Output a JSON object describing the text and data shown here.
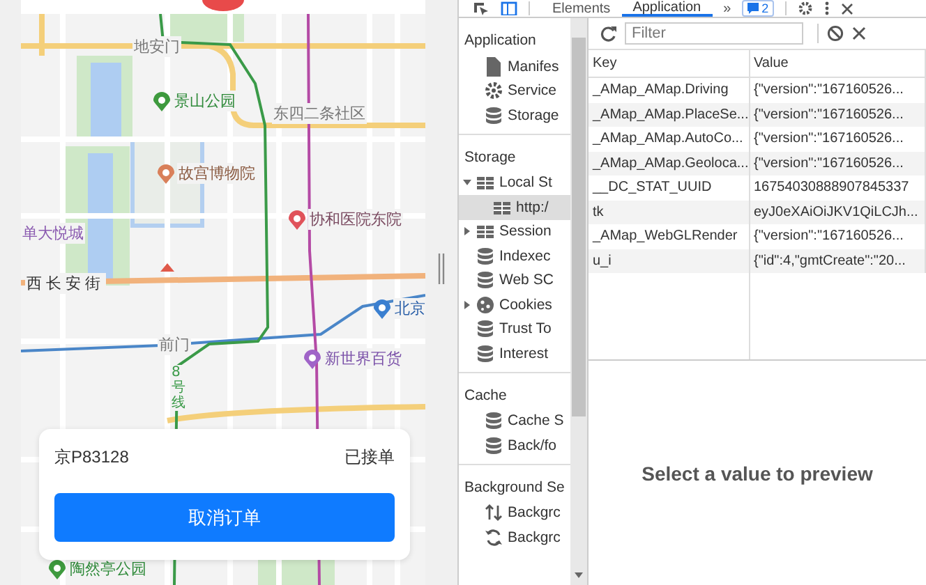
{
  "map": {
    "labels": [
      {
        "text": "地安门",
        "kind": "area"
      },
      {
        "text": "景山公园",
        "kind": "park"
      },
      {
        "text": "东四二条社区",
        "kind": "area"
      },
      {
        "text": "故宫博物院",
        "kind": "museum"
      },
      {
        "text": "协和医院东院",
        "kind": "hospital"
      },
      {
        "text": "单大悦城",
        "kind": "mall"
      },
      {
        "text": "西长安街",
        "kind": "road"
      },
      {
        "text": "北京",
        "kind": "station"
      },
      {
        "text": "前门",
        "kind": "area"
      },
      {
        "text": "新世界百货",
        "kind": "shop"
      },
      {
        "text": "8号线",
        "kind": "metro"
      },
      {
        "text": "陶然亭公园",
        "kind": "park"
      }
    ]
  },
  "order_card": {
    "plate": "京P83128",
    "status": "已接单",
    "cancel_button": "取消订单"
  },
  "devtools": {
    "tabs": [
      {
        "label": "Elements",
        "selected": false
      },
      {
        "label": "Application",
        "selected": true
      }
    ],
    "more_tabs": "»",
    "issues_badge": "2",
    "filter": {
      "placeholder": "Filter"
    },
    "sidebar": [
      {
        "title": "Application",
        "items": [
          {
            "label": "Manifes",
            "kind": "file",
            "selected": false
          },
          {
            "label": "Service",
            "kind": "gear",
            "selected": false
          },
          {
            "label": "Storage",
            "kind": "database",
            "selected": false
          }
        ]
      },
      {
        "title": "Storage",
        "items": [
          {
            "label": "Local St",
            "kind": "table",
            "selected": false,
            "expanded": true,
            "children": [
              {
                "label": "http:/",
                "kind": "table",
                "selected": true
              }
            ]
          },
          {
            "label": "Session",
            "kind": "table",
            "selected": false,
            "expanded": false
          },
          {
            "label": "Indexec",
            "kind": "database",
            "selected": false
          },
          {
            "label": "Web SC",
            "kind": "database",
            "selected": false
          },
          {
            "label": "Cookies",
            "kind": "cookie",
            "selected": false,
            "expanded": false
          },
          {
            "label": "Trust To",
            "kind": "database",
            "selected": false
          },
          {
            "label": "Interest",
            "kind": "database",
            "selected": false
          }
        ]
      },
      {
        "title": "Cache",
        "items": [
          {
            "label": "Cache S",
            "kind": "database",
            "selected": false
          },
          {
            "label": "Back/fo",
            "kind": "database",
            "selected": false
          }
        ]
      },
      {
        "title": "Background Se",
        "items": [
          {
            "label": "Backgrc",
            "kind": "fetch",
            "selected": false
          },
          {
            "label": "Backgrc",
            "kind": "sync",
            "selected": false
          }
        ]
      }
    ],
    "table": {
      "columns": [
        "Key",
        "Value"
      ],
      "rows": [
        [
          "_AMap_AMap.Driving",
          "{\"version\":\"167160526..."
        ],
        [
          "_AMap_AMap.PlaceSe...",
          "{\"version\":\"167160526..."
        ],
        [
          "_AMap_AMap.AutoCo...",
          "{\"version\":\"167160526..."
        ],
        [
          "_AMap_AMap.Geoloca...",
          "{\"version\":\"167160526..."
        ],
        [
          "__DC_STAT_UUID",
          "16754030888907845337"
        ],
        [
          "tk",
          "eyJ0eXAiOiJKV1QiLCJh..."
        ],
        [
          "_AMap_WebGLRender",
          "{\"version\":\"167160526..."
        ],
        [
          "u_i",
          "{\"id\":4,\"gmtCreate\":\"20..."
        ]
      ]
    },
    "preview": "Select a value to preview"
  }
}
